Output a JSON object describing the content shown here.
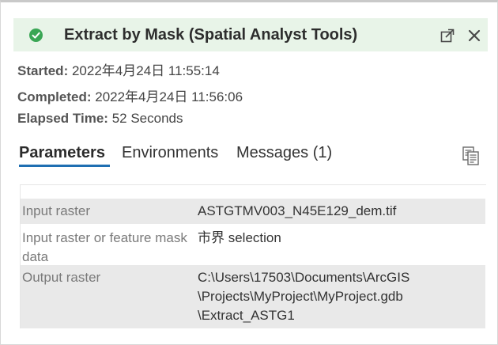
{
  "header": {
    "title": "Extract by Mask (Spatial Analyst Tools)",
    "status_icon": "success-check-icon",
    "status_color": "#3aa655",
    "background": "#e8f4e8"
  },
  "meta": {
    "started_label": "Started:",
    "started_value": "2022年4月24日 11:55:14",
    "completed_label": "Completed:",
    "completed_value": "2022年4月24日 11:56:06",
    "elapsed_label": "Elapsed Time:",
    "elapsed_value": "52 Seconds"
  },
  "tabs": [
    {
      "label": "Parameters",
      "active": true
    },
    {
      "label": "Environments",
      "active": false
    },
    {
      "label": "Messages (1)",
      "active": false
    }
  ],
  "accent_color": "#1f6fb2",
  "parameters": [
    {
      "name": "Input raster",
      "value": "ASTGTMV003_N45E129_dem.tif"
    },
    {
      "name": "Input raster or feature mask data",
      "value": "市界 selection"
    },
    {
      "name": "Output raster",
      "value": "C:\\Users\\17503\\Documents\\ArcGIS\n\\Projects\\MyProject\\MyProject.gdb\n\\Extract_ASTG1"
    }
  ]
}
